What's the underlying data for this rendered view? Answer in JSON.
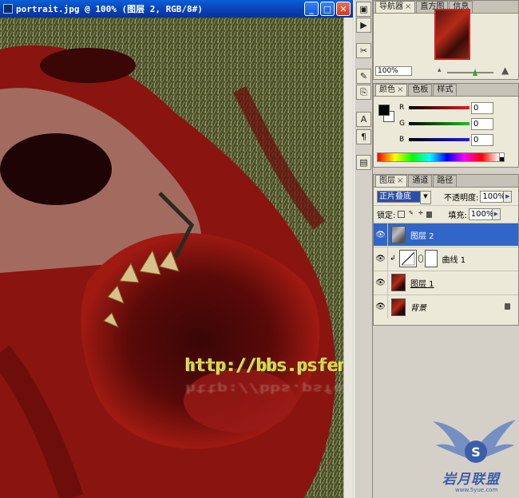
{
  "window": {
    "title": "portrait.jpg @ 100% (图层 2, RGB/8#)",
    "buttons": {
      "minimize": "_",
      "maximize": "□",
      "close": "✕"
    }
  },
  "canvas": {
    "watermark": "http://bbs.psfeng.cn/",
    "colors": {
      "blood": "#8a1410",
      "grass": "#4f5a2a",
      "teeth": "#d8c08a"
    }
  },
  "toolstrip": {
    "icons": [
      "navigator-icon",
      "actions-icon",
      "tools-icon",
      "brush-icon",
      "clone-icon",
      "character-icon",
      "paragraph-icon",
      "layer-comps-icon"
    ]
  },
  "navigator_panel": {
    "tabs": [
      {
        "label": "导航器",
        "close": "×"
      },
      {
        "label": "直方图"
      },
      {
        "label": "信息"
      }
    ],
    "zoom": "100%"
  },
  "color_panel": {
    "tabs": [
      {
        "label": "颜色",
        "close": "×"
      },
      {
        "label": "色板"
      },
      {
        "label": "样式"
      }
    ],
    "channels": [
      {
        "label": "R",
        "value": "0",
        "color": "#e02020"
      },
      {
        "label": "G",
        "value": "0",
        "color": "#20c020"
      },
      {
        "label": "B",
        "value": "0",
        "color": "#2020e0"
      }
    ]
  },
  "layers_panel": {
    "tabs": [
      {
        "label": "图层",
        "close": "×"
      },
      {
        "label": "通道"
      },
      {
        "label": "路径"
      }
    ],
    "blend_mode": "正片叠底",
    "opacity_label": "不透明度:",
    "opacity_value": "100%",
    "lock_label": "锁定:",
    "fill_label": "填充:",
    "fill_value": "100%",
    "layers": [
      {
        "name": "图层 2",
        "selected": true,
        "visible_icon": "eye-icon"
      },
      {
        "name": "曲线 1",
        "selected": false,
        "visible_icon": "eye-icon"
      },
      {
        "name": "图层 1",
        "selected": false,
        "visible_icon": "eye-icon"
      },
      {
        "name": "背景",
        "selected": false,
        "visible_icon": "eye-icon",
        "locked": true
      }
    ]
  },
  "logo": {
    "text": "岩月联盟",
    "url": "www.5yue.com"
  }
}
